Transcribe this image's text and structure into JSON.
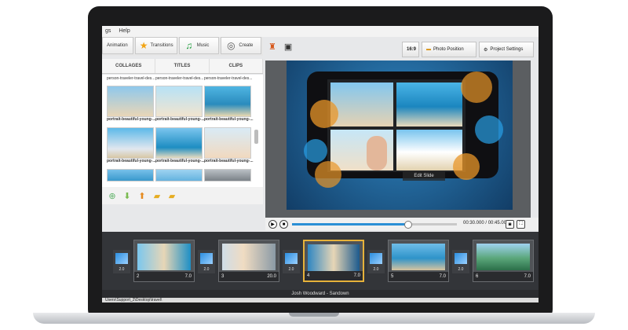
{
  "menu": [
    "gs",
    "Help"
  ],
  "tabs": [
    {
      "label": "Animation",
      "icon": "animation-icon"
    },
    {
      "label": "Transitions",
      "icon": "star-icon"
    },
    {
      "label": "Music",
      "icon": "music-note-icon"
    },
    {
      "label": "Create",
      "icon": "film-reel-icon"
    }
  ],
  "toolbar": {
    "aspect_label": "16:9",
    "photo_position_label": "Photo Position",
    "project_settings_label": "Project Settings"
  },
  "library_tabs": [
    "COLLAGES",
    "TITLES",
    "CLIPS"
  ],
  "library_captions_top": [
    "person-traveler-travel-des...",
    "person-traveler-travel-des...",
    "person-traveler-travel-des..."
  ],
  "library_captions": [
    "portrait-beautiful-young-...",
    "portrait-beautiful-young-...",
    "portrait-beautiful-young-..."
  ],
  "preview": {
    "edit_slide_label": "Edit Slide"
  },
  "player": {
    "time": "00:30.000 / 00:45.000",
    "progress_pct": 70
  },
  "timeline": {
    "slides": [
      {
        "num": "2",
        "duration": "7.0"
      },
      {
        "num": "3",
        "duration": "20.0"
      },
      {
        "num": "4",
        "duration": "7.0"
      },
      {
        "num": "5",
        "duration": "7.0"
      },
      {
        "num": "6",
        "duration": "7.0"
      }
    ],
    "transitions": [
      "2.0",
      "2.0",
      "2.0",
      "2.0",
      "2.0"
    ],
    "audio_track": "Josh Woodward - Sandown",
    "path": "Users\\Support_2\\Desktop\\travel\\"
  },
  "colors": {
    "accent": "#e7b23a",
    "progress": "#2b8fd5"
  }
}
